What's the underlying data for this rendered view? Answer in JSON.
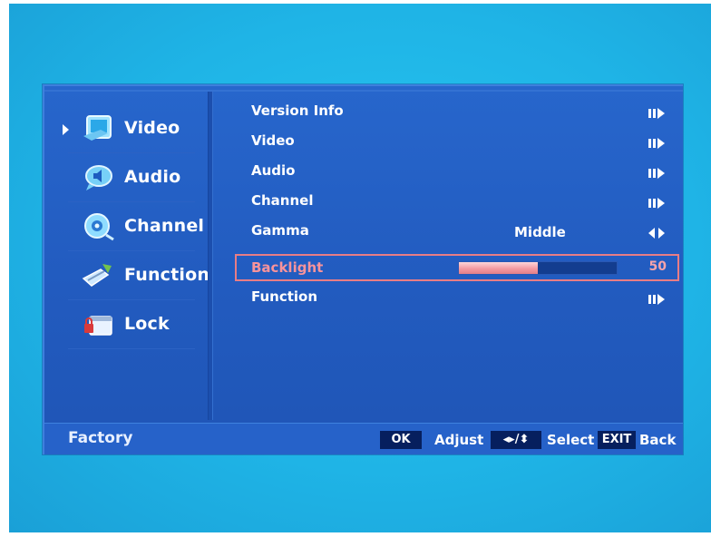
{
  "menu": {
    "sidebar": [
      {
        "label": "Video",
        "icon": "video-icon",
        "active": true
      },
      {
        "label": "Audio",
        "icon": "audio-icon",
        "active": false
      },
      {
        "label": "Channel",
        "icon": "channel-icon",
        "active": false
      },
      {
        "label": "Function",
        "icon": "function-icon",
        "active": false
      },
      {
        "label": "Lock",
        "icon": "lock-icon",
        "active": false
      }
    ],
    "items": [
      {
        "label": "Version Info",
        "arrow": "submenu-arrow-icon"
      },
      {
        "label": "Video",
        "arrow": "submenu-arrow-icon"
      },
      {
        "label": "Audio",
        "arrow": "submenu-arrow-icon"
      },
      {
        "label": "Channel",
        "arrow": "submenu-arrow-icon"
      },
      {
        "label": "Gamma",
        "value": "Middle",
        "arrow": "left-right-arrow-icon"
      },
      {
        "label": "Backlight",
        "value": "50",
        "level_percent": 50,
        "selected": true
      },
      {
        "label": "Function",
        "arrow": "submenu-arrow-icon"
      }
    ]
  },
  "footer": {
    "title": "Factory",
    "ok_key": "OK",
    "ok_label": "Adjust",
    "nav_key": "◂▸/⬍",
    "nav_label": "Select",
    "exit_key": "EXIT",
    "exit_label": "Back"
  },
  "colors": {
    "background": "#1fb4e6",
    "panel": "#2360c4",
    "highlight": "#e87d86",
    "key_bg": "#061f5e"
  }
}
